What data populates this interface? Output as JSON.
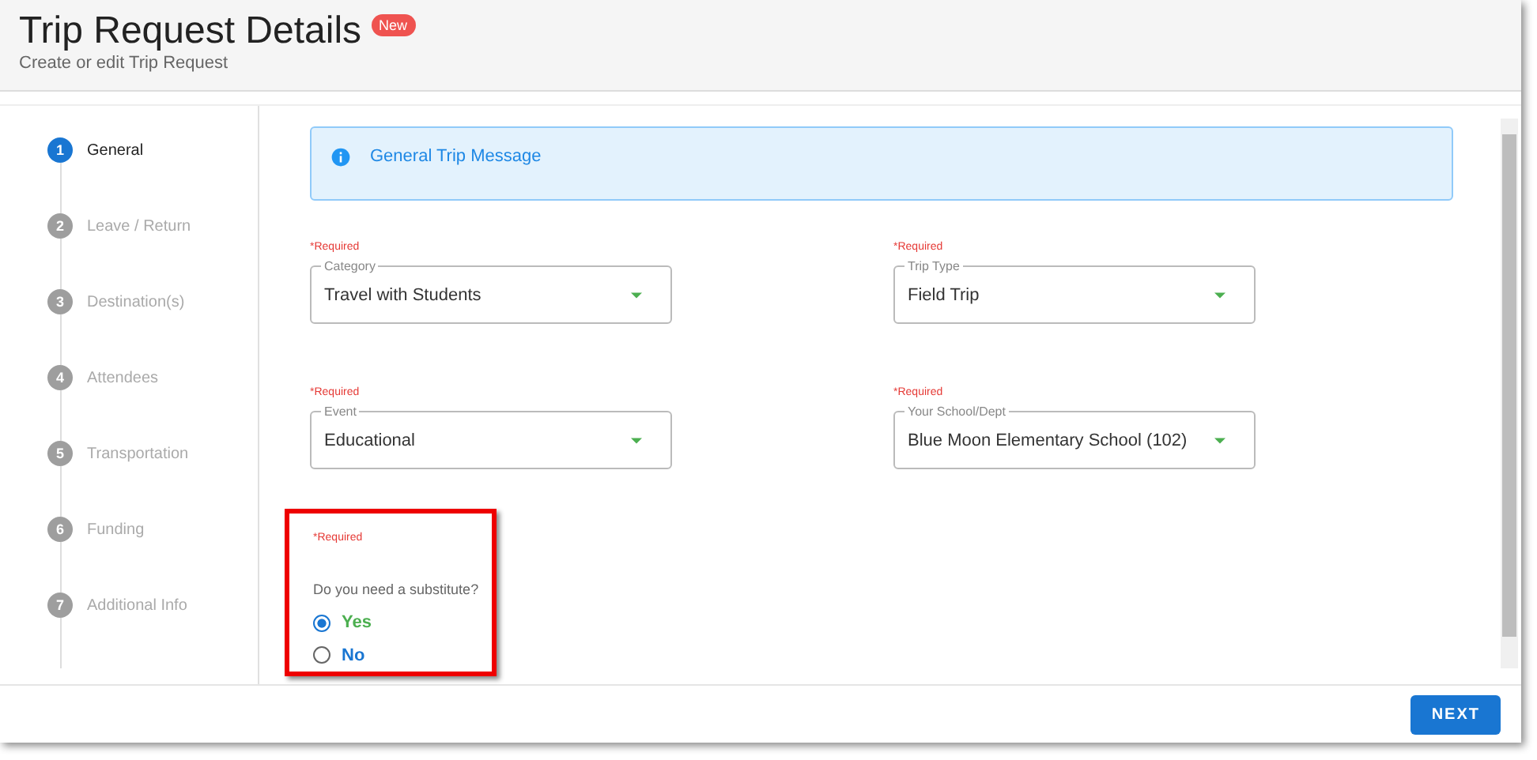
{
  "header": {
    "title": "Trip Request Details",
    "badge": "New",
    "subtitle": "Create or edit Trip Request"
  },
  "steps": [
    {
      "number": "1",
      "label": "General",
      "selected": true
    },
    {
      "number": "2",
      "label": "Leave / Return",
      "selected": false
    },
    {
      "number": "3",
      "label": "Destination(s)",
      "selected": false
    },
    {
      "number": "4",
      "label": "Attendees",
      "selected": false
    },
    {
      "number": "5",
      "label": "Transportation",
      "selected": false
    },
    {
      "number": "6",
      "label": "Funding",
      "selected": false
    },
    {
      "number": "7",
      "label": "Additional Info",
      "selected": false
    }
  ],
  "message": {
    "text": "General Trip Message"
  },
  "fields": [
    {
      "required": "*Required",
      "label": "Category",
      "value": "Travel with Students"
    },
    {
      "required": "*Required",
      "label": "Trip Type",
      "value": "Field Trip"
    },
    {
      "required": "*Required",
      "label": "Event",
      "value": "Educational"
    },
    {
      "required": "*Required",
      "label": "Your School/Dept",
      "value": "Blue Moon Elementary School (102)"
    }
  ],
  "substitute": {
    "required": "*Required",
    "question": "Do you need a substitute?",
    "highlighted": true,
    "options": [
      {
        "label": "Yes",
        "selected": true,
        "color": "#4caf50"
      },
      {
        "label": "No",
        "selected": false,
        "color": "#1976d2"
      }
    ]
  },
  "footer": {
    "button": "NEXT"
  }
}
